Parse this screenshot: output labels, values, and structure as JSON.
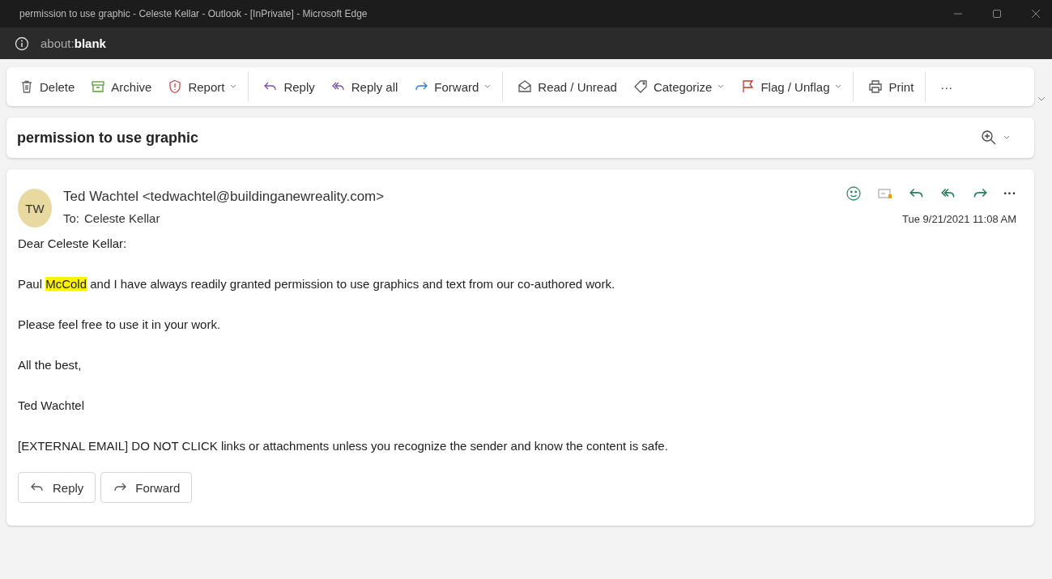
{
  "window": {
    "title": "permission to use graphic - Celeste Kellar - Outlook - [InPrivate] - Microsoft Edge"
  },
  "address_bar": {
    "prefix": "about:",
    "host": "blank"
  },
  "toolbar": [
    {
      "label": "Delete",
      "dropdown": false,
      "separator_after": false
    },
    {
      "label": "Archive",
      "dropdown": false,
      "separator_after": false
    },
    {
      "label": "Report",
      "dropdown": true,
      "separator_after": true
    },
    {
      "label": "Reply",
      "dropdown": false,
      "separator_after": false
    },
    {
      "label": "Reply all",
      "dropdown": false,
      "separator_after": false
    },
    {
      "label": "Forward",
      "dropdown": true,
      "separator_after": true
    },
    {
      "label": "Read / Unread",
      "dropdown": false,
      "separator_after": false
    },
    {
      "label": "Categorize",
      "dropdown": true,
      "separator_after": false
    },
    {
      "label": "Flag / Unflag",
      "dropdown": true,
      "separator_after": true
    },
    {
      "label": "Print",
      "dropdown": false,
      "separator_after": true
    },
    {
      "label": "···",
      "dropdown": false,
      "separator_after": false
    }
  ],
  "subject": "permission to use graphic",
  "message": {
    "avatar": "TW",
    "from": "Ted Wachtel <tedwachtel@buildinganewreality.com>",
    "to_label": "To:",
    "to": "Celeste Kellar",
    "date": "Tue 9/21/2021 11:08 AM",
    "more": "···",
    "body": [
      [
        {
          "text": "Dear Celeste Kellar:",
          "highlight": false
        }
      ],
      [
        {
          "text": "Paul ",
          "highlight": false
        },
        {
          "text": "McCold",
          "highlight": true
        },
        {
          "text": " and I have always readily granted permission to use graphics and text from our co-authored work.",
          "highlight": false
        }
      ],
      [
        {
          "text": "Please feel free to use it in your work.",
          "highlight": false
        }
      ],
      [
        {
          "text": "All the best,",
          "highlight": false
        }
      ],
      [
        {
          "text": "Ted Wachtel",
          "highlight": false
        }
      ],
      [
        {
          "text": "[EXTERNAL EMAIL] DO NOT CLICK links or attachments unless you recognize the sender and know the content is safe.",
          "highlight": false
        }
      ]
    ],
    "buttons": [
      "Reply",
      "Forward"
    ]
  }
}
